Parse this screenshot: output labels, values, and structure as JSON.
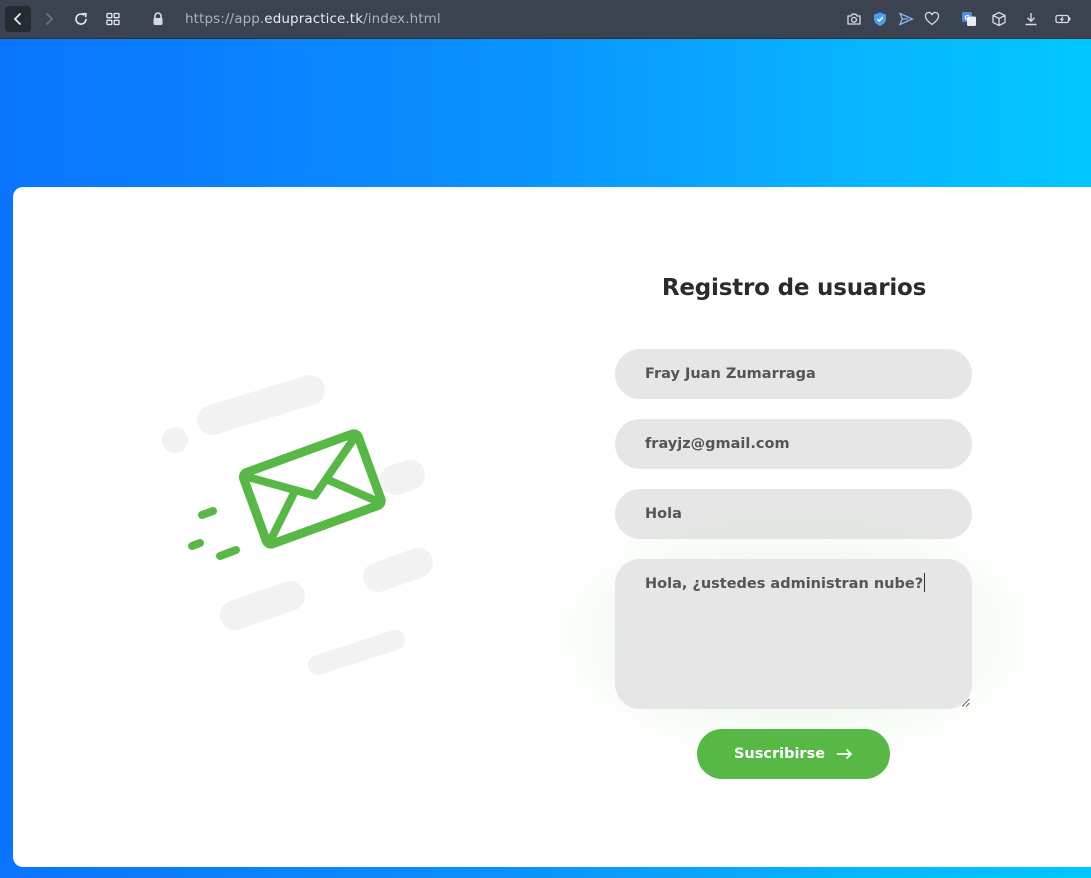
{
  "browser": {
    "url_prefix": "https://app.",
    "url_host": "edupractice.tk",
    "url_path": "/index.html"
  },
  "form": {
    "title": "Registro de usuarios",
    "name_value": "Fray Juan Zumarraga",
    "email_value": "frayjz@gmail.com",
    "subject_value": "Hola",
    "message_value": "Hola, ¿ustedes administran nube?",
    "submit_label": "Suscribirse"
  },
  "colors": {
    "accent_green": "#57b846",
    "field_bg": "#e6e6e6",
    "gradient_start": "#0a74ff",
    "gradient_end": "#00c7ff"
  },
  "icons": {
    "illustration": "envelope-icon",
    "submit": "arrow-right-icon"
  }
}
